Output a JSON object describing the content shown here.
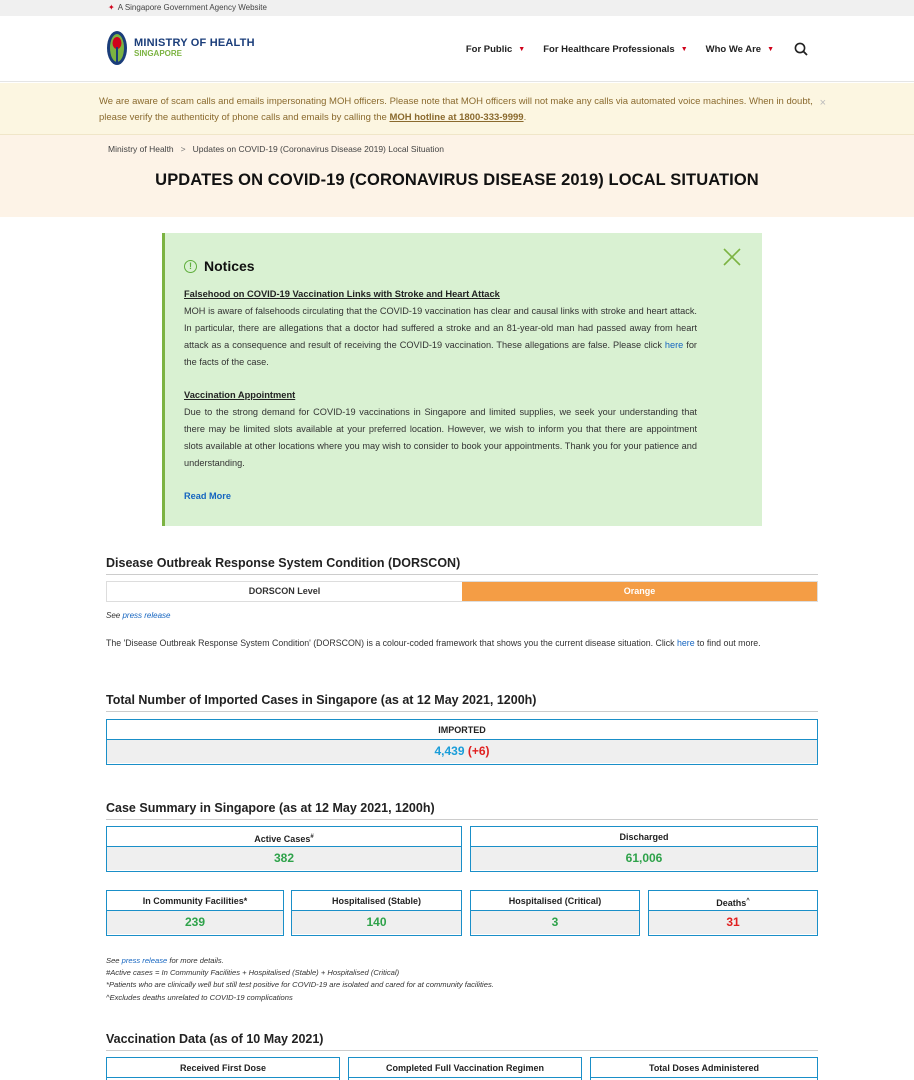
{
  "gov_bar": {
    "text": "A Singapore Government Agency Website"
  },
  "logo": {
    "line1": "MINISTRY OF HEALTH",
    "line2": "SINGAPORE"
  },
  "nav": [
    {
      "label": "For Public"
    },
    {
      "label": "For Healthcare Professionals"
    },
    {
      "label": "Who We Are"
    }
  ],
  "alert": {
    "text": "We are aware of scam calls and emails impersonating MOH officers. Please note that MOH officers will not make any calls via automated voice machines. When in doubt, please verify the authenticity of phone calls and emails by calling the ",
    "link": "MOH hotline at 1800-333-9999",
    "end": ".",
    "close": "×"
  },
  "breadcrumb": {
    "home": "Ministry of Health",
    "sep": ">",
    "current": "Updates on COVID-19 (Coronavirus Disease 2019) Local Situation"
  },
  "page_title": "UPDATES ON COVID-19 (CORONAVIRUS DISEASE 2019) LOCAL SITUATION",
  "notices": {
    "title": "Notices",
    "item1_title": "Falsehood on COVID-19 Vaccination Links with Stroke and Heart Attack",
    "item1_text": "MOH is aware of falsehoods circulating that the COVID-19 vaccination has clear and causal links with stroke and heart attack. In particular, there are allegations that a doctor had suffered a stroke and an 81-year-old man had passed away from heart attack as a consequence and result of receiving the COVID-19 vaccination. These allegations are false. Please click ",
    "item1_link": "here",
    "item1_end": " for the facts of the case.",
    "item2_title": "Vaccination Appointment",
    "item2_text": "Due to the strong demand for COVID-19 vaccinations in Singapore and limited supplies, we seek your understanding that there may be limited slots available at your preferred location. However, we wish to inform you that there are appointment slots available at other locations where you may wish to consider to book your appointments. Thank you for your patience and understanding.",
    "read_more": "Read More"
  },
  "dorscon": {
    "heading": "Disease Outbreak Response System Condition (DORSCON)",
    "label": "DORSCON Level",
    "value": "Orange",
    "value_color": "#f49d45",
    "see": "See ",
    "press_link": "press release",
    "desc": "The 'Disease Outbreak Response System Condition' (DORSCON) is a colour-coded framework that shows you the current disease situation.  Click ",
    "desc_link": "here",
    "desc_end": " to find out more."
  },
  "imported": {
    "heading": "Total Number of Imported Cases in Singapore (as at 12 May 2021, 1200h)",
    "label": "IMPORTED",
    "value": "4,439",
    "delta": "(+6)"
  },
  "summary": {
    "heading": "Case Summary in Singapore (as at 12 May 2021, 1200h)",
    "active_label": "Active Cases",
    "active_sup": "#",
    "active_value": "382",
    "discharged_label": "Discharged",
    "discharged_value": "61,006",
    "community_label": "In Community Facilities",
    "community_sup": "*",
    "community_value": "239",
    "stable_label": "Hospitalised (Stable)",
    "stable_value": "140",
    "critical_label": "Hospitalised (Critical)",
    "critical_value": "3",
    "deaths_label": "Deaths",
    "deaths_sup": "^",
    "deaths_value": "31"
  },
  "footnotes": {
    "see": "See ",
    "press_link": "press release",
    "see_end": " for more details.",
    "note1": "#Active cases = In Community Facilities + Hospitalised (Stable) + Hospitalised (Critical)",
    "note2": "*Patients who are clinically well but still test positive for COVID-19 are isolated and cared for at community facilities.",
    "note3": "^Excludes deaths unrelated to COVID-19 complications"
  },
  "vaccination": {
    "heading": "Vaccination Data (as of 10 May 2021)",
    "first_dose": "Received First Dose",
    "full_regimen": "Completed Full Vaccination Regimen",
    "total_doses": "Total Doses Administered"
  }
}
